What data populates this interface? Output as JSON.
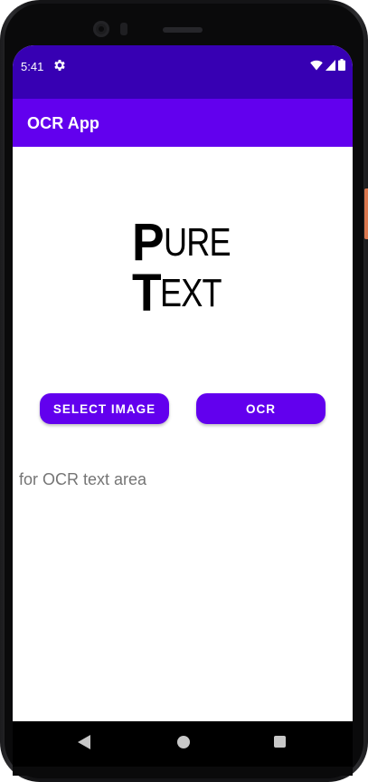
{
  "status_bar": {
    "time": "5:41",
    "settings_icon": "gear-icon",
    "wifi_icon": "wifi-icon",
    "signal_icon": "cell-signal-icon",
    "battery_icon": "battery-icon"
  },
  "app_bar": {
    "title": "OCR App"
  },
  "logo": {
    "line1_initial": "P",
    "line1_rest": "URE",
    "line2_initial": "T",
    "line2_rest": "EXT"
  },
  "buttons": {
    "select_image": "SELECT IMAGE",
    "ocr": "OCR"
  },
  "ocr_output": {
    "text": "for OCR text area"
  },
  "nav_bar": {
    "back_icon": "back-triangle-icon",
    "home_icon": "home-circle-icon",
    "recents_icon": "recents-square-icon"
  },
  "colors": {
    "status_bar": "#3700b3",
    "primary": "#6200ee",
    "on_primary": "#ffffff",
    "text_secondary": "#757575"
  }
}
